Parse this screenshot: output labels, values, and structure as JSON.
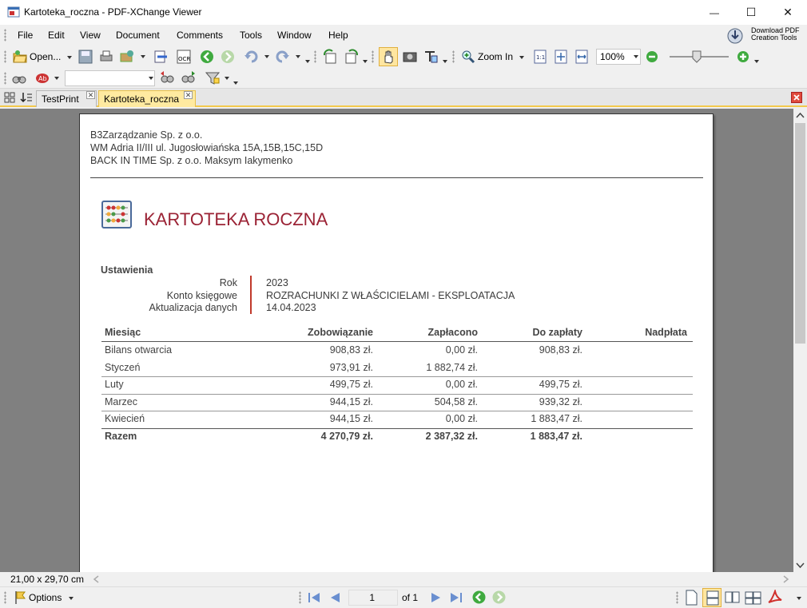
{
  "window": {
    "title": "Kartoteka_roczna - PDF-XChange Viewer",
    "minimize_glyph": "—",
    "maximize_glyph": "☐",
    "close_glyph": "✕"
  },
  "menu": [
    "File",
    "Edit",
    "View",
    "Document",
    "Comments",
    "Tools",
    "Window",
    "Help"
  ],
  "promo": {
    "line1": "Download PDF",
    "line2": "Creation Tools"
  },
  "toolbar": {
    "open_label": "Open...",
    "zoom_in_label": "Zoom In",
    "zoom_value": "100%"
  },
  "tabs": [
    {
      "label": "TestPrint",
      "active": false
    },
    {
      "label": "Kartoteka_roczna",
      "active": true
    }
  ],
  "document": {
    "header_lines": [
      "B3Zarządzanie Sp. z o.o.",
      "WM Adria II/III ul. Jugosłowiańska 15A,15B,15C,15D",
      "BACK IN TIME Sp. z o.o. Maksym Iakymenko"
    ],
    "title": "KARTOTEKA ROCZNA",
    "settings_heading": "Ustawienia",
    "settings": [
      {
        "label": "Rok",
        "value": "2023"
      },
      {
        "label": "Konto księgowe",
        "value": "ROZRACHUNKI Z WŁAŚCICIELAMI - EKSPLOATACJA"
      },
      {
        "label": "Aktualizacja danych",
        "value": "14.04.2023"
      }
    ],
    "table": {
      "columns": [
        "Miesiąc",
        "Zobowiązanie",
        "Zapłacono",
        "Do zapłaty",
        "Nadpłata"
      ],
      "rows": [
        [
          "Bilans otwarcia",
          "908,83 zł.",
          "0,00 zł.",
          "908,83 zł.",
          ""
        ],
        [
          "Styczeń",
          "973,91 zł.",
          "1 882,74 zł.",
          "",
          ""
        ],
        [
          "Luty",
          "499,75 zł.",
          "0,00 zł.",
          "499,75 zł.",
          ""
        ],
        [
          "Marzec",
          "944,15 zł.",
          "504,58 zł.",
          "939,32 zł.",
          ""
        ],
        [
          "Kwiecień",
          "944,15 zł.",
          "0,00 zł.",
          "1 883,47 zł.",
          ""
        ]
      ],
      "total": [
        "Razem",
        "4 270,79 zł.",
        "2 387,32 zł.",
        "1 883,47 zł.",
        ""
      ]
    },
    "colors": {
      "title": "#9b2335",
      "settings_bar": "#c0392b"
    }
  },
  "status": {
    "page_size": "21,00 x 29,70 cm",
    "options_label": "Options",
    "page_current": "1",
    "page_of": "of 1"
  }
}
